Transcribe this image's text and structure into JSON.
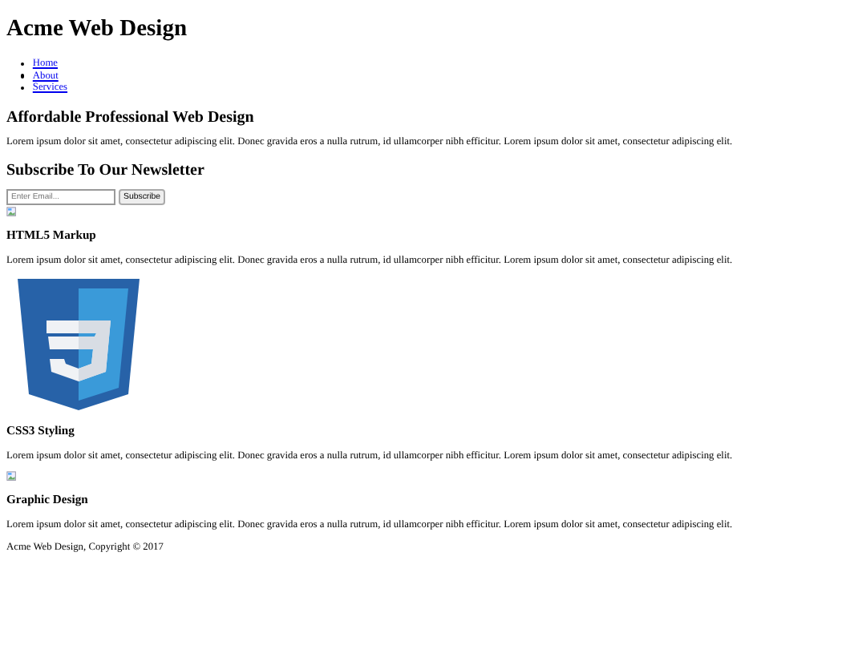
{
  "site_title": "Acme Web Design",
  "nav": [
    "Home",
    "About",
    "Services"
  ],
  "hero": {
    "heading": "Affordable Professional Web Design",
    "text": "Lorem ipsum dolor sit amet, consectetur adipiscing elit. Donec gravida eros a nulla rutrum, id ullamcorper nibh efficitur. Lorem ipsum dolor sit amet, consectetur adipiscing elit."
  },
  "newsletter": {
    "heading": "Subscribe To Our Newsletter",
    "placeholder": "Enter Email...",
    "button": "Subscribe"
  },
  "features": [
    {
      "kind": "broken-image",
      "heading": "HTML5 Markup",
      "text": "Lorem ipsum dolor sit amet, consectetur adipiscing elit. Donec gravida eros a nulla rutrum, id ullamcorper nibh efficitur. Lorem ipsum dolor sit amet, consectetur adipiscing elit."
    },
    {
      "kind": "logo",
      "heading": "CSS3 Styling",
      "text": "Lorem ipsum dolor sit amet, consectetur adipiscing elit. Donec gravida eros a nulla rutrum, id ullamcorper nibh efficitur. Lorem ipsum dolor sit amet, consectetur adipiscing elit."
    },
    {
      "kind": "broken-image",
      "heading": "Graphic Design",
      "text": "Lorem ipsum dolor sit amet, consectetur adipiscing elit. Donec gravida eros a nulla rutrum, id ullamcorper nibh efficitur. Lorem ipsum dolor sit amet, consectetur adipiscing elit."
    }
  ],
  "footer": "Acme Web Design, Copyright © 2017"
}
